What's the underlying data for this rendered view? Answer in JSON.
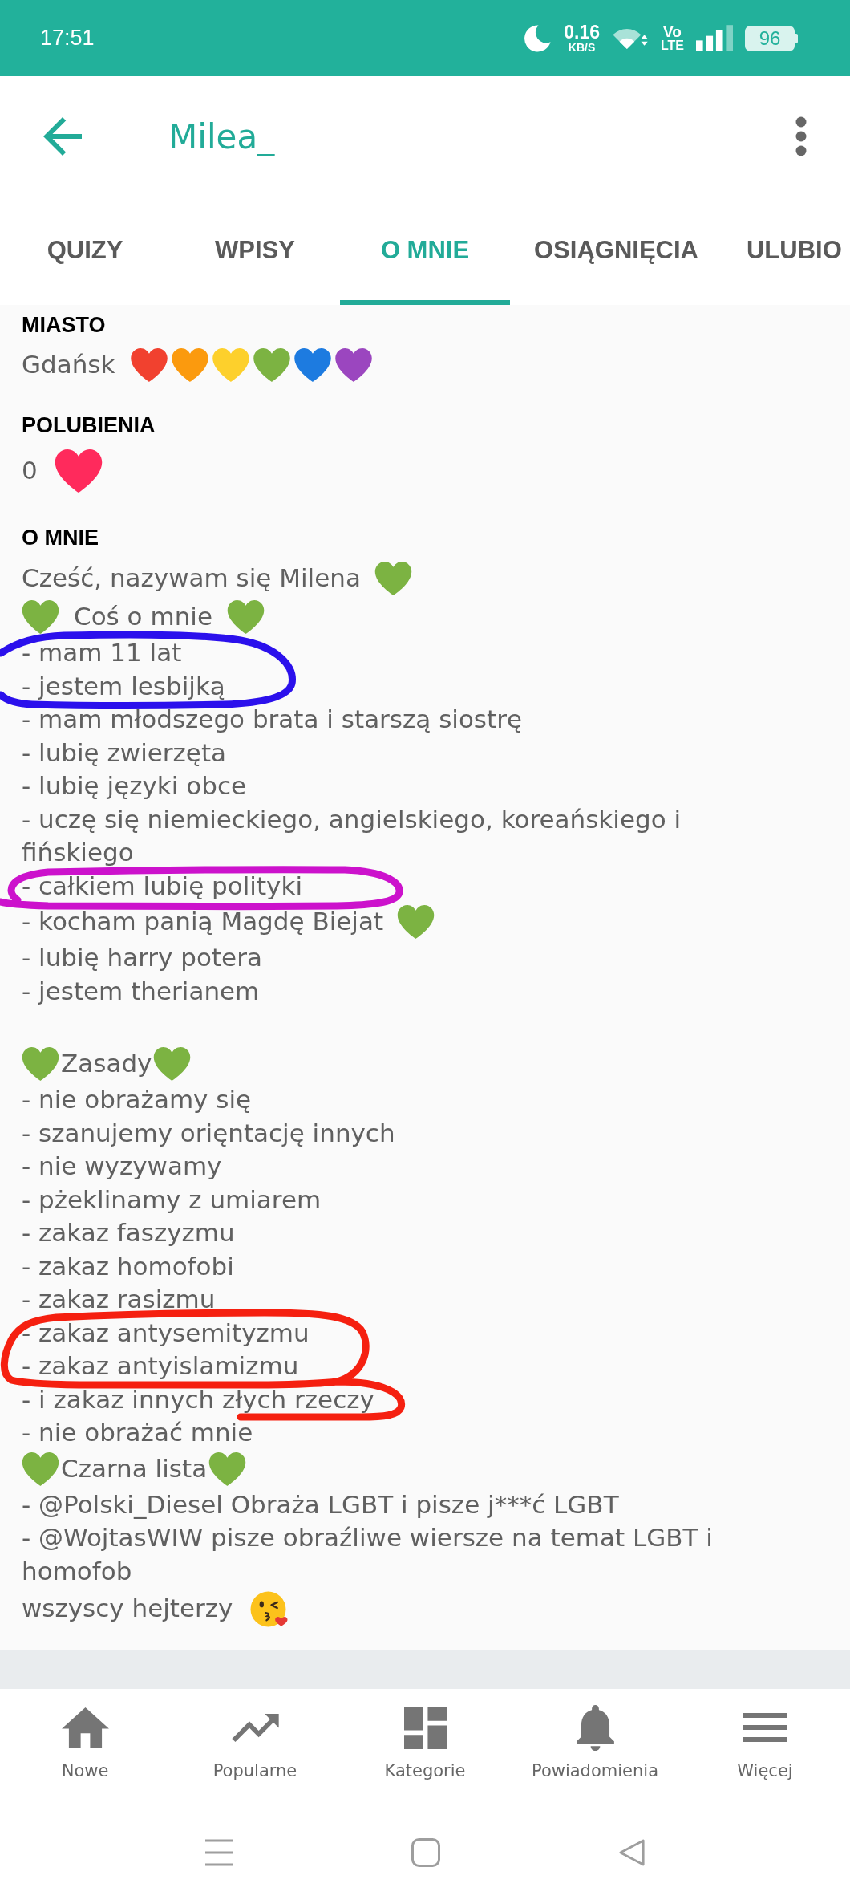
{
  "status_bar": {
    "time": "17:51",
    "data_speed": "0.16",
    "data_unit": "KB/S",
    "network_top": "Vo",
    "network_bottom": "LTE",
    "battery": "96"
  },
  "header": {
    "title": "Milea_"
  },
  "tabs": [
    {
      "label": "QUIZY",
      "selected": false
    },
    {
      "label": "WPISY",
      "selected": false
    },
    {
      "label": "O MNIE",
      "selected": true
    },
    {
      "label": "OSIĄGNIĘCIA",
      "selected": false
    },
    {
      "label": "ULUBIO",
      "selected": false
    }
  ],
  "profile": {
    "city": {
      "label": "MIASTO",
      "value": "Gdańsk",
      "hearts": [
        {
          "color": "#f1412f"
        },
        {
          "color": "#fb9a0e"
        },
        {
          "color": "#fdd02c"
        },
        {
          "color": "#7cb342"
        },
        {
          "color": "#1d7be0"
        },
        {
          "color": "#9b46bf"
        }
      ]
    },
    "likes": {
      "label": "POLUBIENIA",
      "count": "0"
    },
    "about": {
      "label": "O MNIE",
      "lines": [
        {
          "kind": "heart",
          "text": "Cześć, nazywam się Milena"
        },
        {
          "kind": "spaced-hearts",
          "text": "Coś o mnie"
        },
        {
          "kind": "text",
          "text": "- mam 11 lat"
        },
        {
          "kind": "text",
          "text": "- jestem lesbijką"
        },
        {
          "kind": "text",
          "text": "- mam młodszego brata i starszą siostrę"
        },
        {
          "kind": "text",
          "text": "- lubię zwierzęta"
        },
        {
          "kind": "text",
          "text": "- lubię języki obce"
        },
        {
          "kind": "text",
          "text": "- uczę się niemieckiego, angielskiego, koreańskiego i fińskiego"
        },
        {
          "kind": "text",
          "text": "- całkiem lubię polityki"
        },
        {
          "kind": "heart",
          "text": "- kocham panią Magdę Biejat"
        },
        {
          "kind": "text",
          "text": "- lubię harry potera"
        },
        {
          "kind": "text",
          "text": "- jestem therianem"
        },
        {
          "kind": "blank"
        },
        {
          "kind": "hearts",
          "text": "Zasady"
        },
        {
          "kind": "text",
          "text": "- nie obrażamy się"
        },
        {
          "kind": "text",
          "text": "- szanujemy orięntację innych"
        },
        {
          "kind": "text",
          "text": "- nie wyzywamy"
        },
        {
          "kind": "text",
          "text": "- pżeklinamy z umiarem"
        },
        {
          "kind": "text",
          "text": "- zakaz faszyzmu"
        },
        {
          "kind": "text",
          "text": "- zakaz homofobi"
        },
        {
          "kind": "text",
          "text": "- zakaz rasizmu"
        },
        {
          "kind": "text",
          "text": "- zakaz antysemityzmu"
        },
        {
          "kind": "text",
          "text": "- zakaz antyislamizmu"
        },
        {
          "kind": "text",
          "text": "- i zakaz innych złych rzeczy"
        },
        {
          "kind": "text",
          "text": "- nie obrażać mnie"
        },
        {
          "kind": "hearts",
          "text": "Czarna lista"
        },
        {
          "kind": "text",
          "text": "- @Polski_Diesel Obraża LGBT i pisze j***ć LGBT"
        },
        {
          "kind": "text",
          "text": "- @WojtasWIW pisze obraźliwe wiersze na temat LGBT i homofob"
        },
        {
          "kind": "kiss",
          "text": "wszyscy hejterzy"
        }
      ]
    }
  },
  "scribbles": [
    {
      "color": "#2b10ec"
    },
    {
      "color": "#cc12cc"
    },
    {
      "color": "#f52010"
    }
  ],
  "bottom_nav": [
    {
      "label": "Nowe"
    },
    {
      "label": "Popularne"
    },
    {
      "label": "Kategorie"
    },
    {
      "label": "Powiadomienia"
    },
    {
      "label": "Więcej"
    }
  ]
}
